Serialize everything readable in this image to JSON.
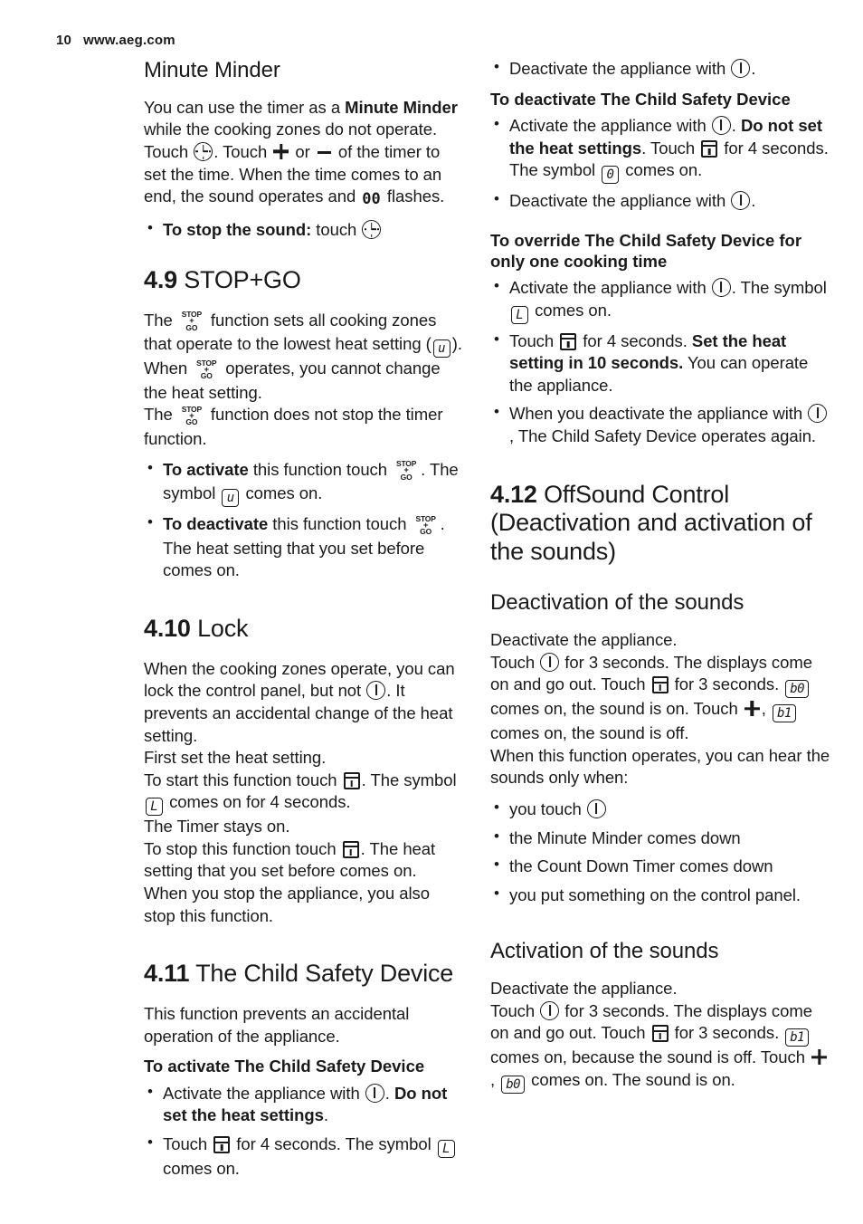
{
  "runhead": {
    "page_number": "10",
    "site": "www.aeg.com"
  },
  "icons": {
    "power": "power-on-off-icon",
    "timer": "timer-clock-icon",
    "lock": "lock-pad-icon",
    "plus": "plus-icon",
    "minus": "minus-icon",
    "stopgo": "stop-go-icon",
    "stopgo_l1": "STOP",
    "stopgo_l2": "+",
    "stopgo_l3": "GO",
    "disp_u": "u",
    "disp_L": "L",
    "disp_0": "0",
    "disp_b0": "b0",
    "disp_b1": "b1",
    "seg_00": "00"
  },
  "left_column": {
    "minute_minder": {
      "heading": "Minute Minder",
      "para_1a": "You can use the timer as a ",
      "para_1b": "Minute Minder",
      "para_1c": " while the cooking zones do not operate. Touch ",
      "para_1d": ". Touch ",
      "para_1e": " or ",
      "para_1f": " of the timer to set the time. When the time comes to an end, the sound operates and ",
      "para_1g": " flashes.",
      "bullet_1a": "To stop the sound:",
      "bullet_1b": " touch "
    },
    "stop_go": {
      "num": "4.9",
      "title": "STOP+GO",
      "p1a": "The ",
      "p1b": " function sets all cooking zones that operate to the lowest heat setting (",
      "p1c": ").",
      "p2a": "When ",
      "p2b": " operates, you cannot change the heat setting.",
      "p3a": "The ",
      "p3b": " function does not stop the timer function.",
      "b1a": "To activate",
      "b1b": " this function touch ",
      "b1c": ". The symbol ",
      "b1d": " comes on.",
      "b2a": "To deactivate",
      "b2b": " this function touch ",
      "b2c": ". The heat setting that you set before comes on."
    },
    "lock": {
      "num": "4.10",
      "title": "Lock",
      "p1a": "When the cooking zones operate, you can lock the control panel, but not ",
      "p1b": ". It prevents an accidental change of the heat setting.",
      "p2": "First set the heat setting.",
      "p3a": "To start this function touch ",
      "p3b": ". The symbol ",
      "p3c": " comes on for 4 seconds.",
      "p4": "The Timer stays on.",
      "p5a": "To stop this function touch ",
      "p5b": ". The heat setting that you set before comes on. When you stop the appliance, you also stop this function."
    },
    "child_safety": {
      "num": "4.11",
      "title": "The Child Safety Device",
      "p1": "This function prevents an accidental operation of the appliance.",
      "h_activate": "To activate The Child Safety Device",
      "b1a": "Activate the appliance with ",
      "b1b": ". ",
      "b1c": "Do not set the heat settings",
      "b1d": ".",
      "b2a": "Touch ",
      "b2b": " for 4 seconds. The symbol ",
      "b2c": " comes on."
    }
  },
  "right_column": {
    "child_safety_cont": {
      "b0a": "Deactivate the appliance with ",
      "b0b": ".",
      "h_deactivate": "To deactivate The Child Safety Device",
      "b1a": "Activate the appliance with ",
      "b1b": ". ",
      "b1c": "Do not set the heat settings",
      "b1d": ". Touch ",
      "b1e": " for 4 seconds. The symbol ",
      "b1f": " comes on.",
      "b2a": "Deactivate the appliance with ",
      "b2b": ".",
      "h_override": "To override The Child Safety Device for only one cooking time",
      "b3a": "Activate the appliance with ",
      "b3b": ". The symbol ",
      "b3c": " comes on.",
      "b4a": "Touch ",
      "b4b": " for 4 seconds. ",
      "b4c": "Set the heat setting in 10 seconds.",
      "b4d": " You can operate the appliance.",
      "b5a": "When you deactivate the appliance with ",
      "b5b": ", The Child Safety Device operates again."
    },
    "offsound": {
      "num": "4.12",
      "title": "OffSound Control (Deactivation and activation of the sounds)",
      "deactivation": {
        "heading": "Deactivation of the sounds",
        "p1": "Deactivate the appliance.",
        "p2a": "Touch ",
        "p2b": " for 3 seconds. The displays come on and go out. Touch ",
        "p2c": " for 3 seconds. ",
        "p2d": " comes on, the sound is on. Touch ",
        "p2e": ", ",
        "p2f": " comes on, the sound is off.",
        "p3": "When this function operates, you can hear the sounds only when:",
        "bullets": [
          "you touch ",
          "the Minute Minder comes down",
          "the Count Down Timer comes down",
          "you put something on the control panel."
        ]
      },
      "activation": {
        "heading": "Activation of the sounds",
        "p1": "Deactivate the appliance.",
        "p2a": "Touch ",
        "p2b": " for 3 seconds. The displays come on and go out. Touch ",
        "p2c": " for 3 seconds. ",
        "p2d": " comes on, because the sound is off. Touch ",
        "p2e": ", ",
        "p2f": " comes on. The sound is on."
      }
    }
  }
}
